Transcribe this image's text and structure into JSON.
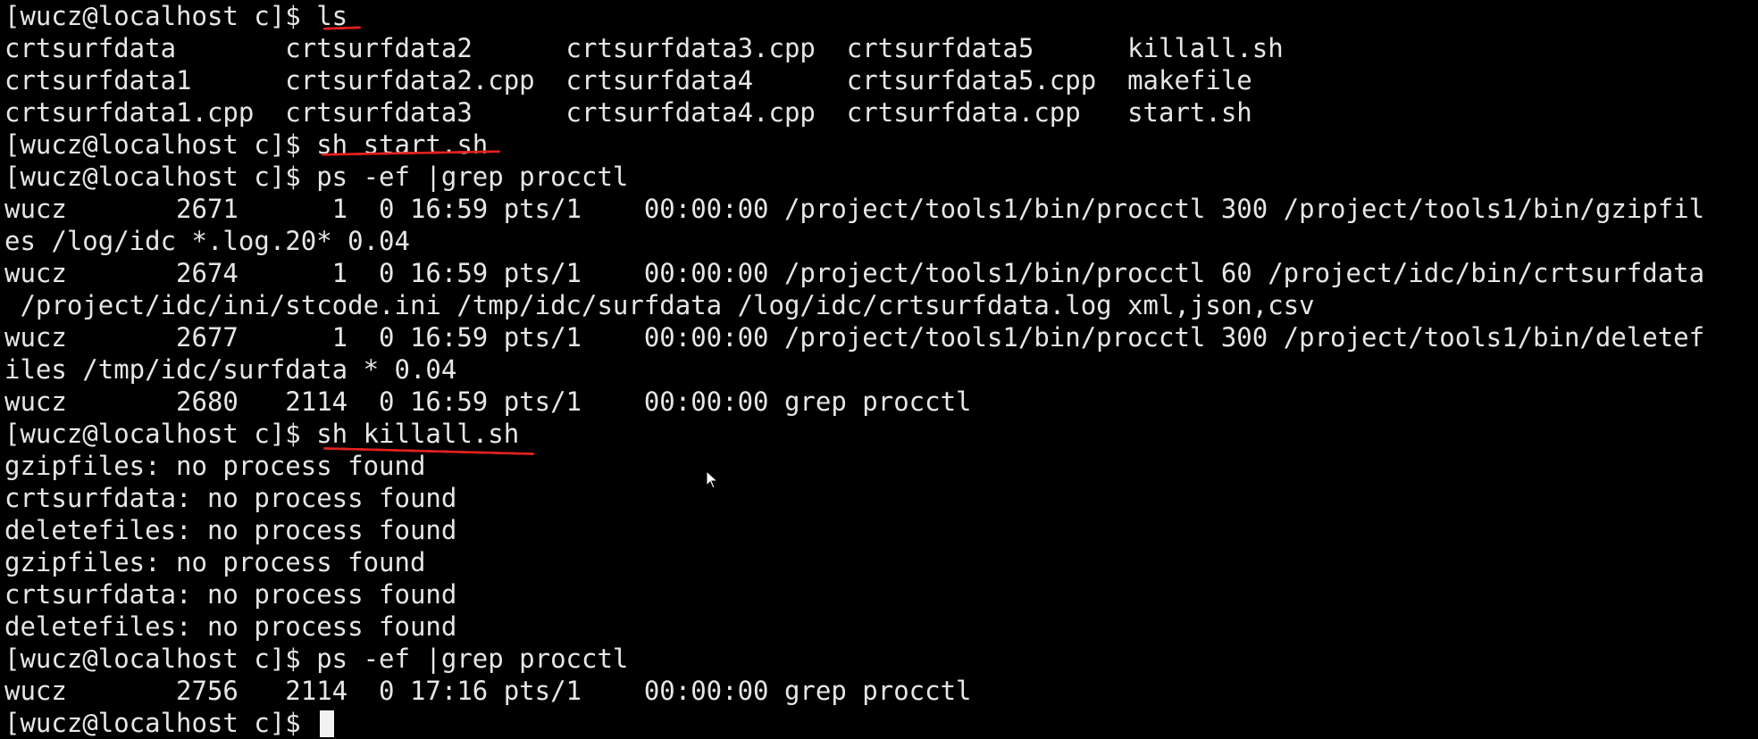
{
  "terminal": {
    "lines": [
      {
        "prompt": "[wucz@localhost c]$ ",
        "command": "ls"
      },
      {
        "text": "crtsurfdata       crtsurfdata2      crtsurfdata3.cpp  crtsurfdata5      killall.sh"
      },
      {
        "text": "crtsurfdata1      crtsurfdata2.cpp  crtsurfdata4      crtsurfdata5.cpp  makefile"
      },
      {
        "text": "crtsurfdata1.cpp  crtsurfdata3      crtsurfdata4.cpp  crtsurfdata.cpp   start.sh"
      },
      {
        "prompt": "[wucz@localhost c]$ ",
        "command": "sh start.sh"
      },
      {
        "prompt": "[wucz@localhost c]$ ",
        "command": "ps -ef |grep procctl"
      },
      {
        "text": "wucz       2671      1  0 16:59 pts/1    00:00:00 /project/tools1/bin/procctl 300 /project/tools1/bin/gzipfil"
      },
      {
        "text": "es /log/idc *.log.20* 0.04"
      },
      {
        "text": "wucz       2674      1  0 16:59 pts/1    00:00:00 /project/tools1/bin/procctl 60 /project/idc/bin/crtsurfdata"
      },
      {
        "text": " /project/idc/ini/stcode.ini /tmp/idc/surfdata /log/idc/crtsurfdata.log xml,json,csv"
      },
      {
        "text": "wucz       2677      1  0 16:59 pts/1    00:00:00 /project/tools1/bin/procctl 300 /project/tools1/bin/deletef"
      },
      {
        "text": "iles /tmp/idc/surfdata * 0.04"
      },
      {
        "text": "wucz       2680   2114  0 16:59 pts/1    00:00:00 grep procctl"
      },
      {
        "prompt": "[wucz@localhost c]$ ",
        "command": "sh killall.sh"
      },
      {
        "text": "gzipfiles: no process found"
      },
      {
        "text": "crtsurfdata: no process found"
      },
      {
        "text": "deletefiles: no process found"
      },
      {
        "text": "gzipfiles: no process found"
      },
      {
        "text": "crtsurfdata: no process found"
      },
      {
        "text": "deletefiles: no process found"
      },
      {
        "prompt": "[wucz@localhost c]$ ",
        "command": "ps -ef |grep procctl"
      },
      {
        "text": "wucz       2756   2114  0 17:16 pts/1    00:00:00 grep procctl"
      },
      {
        "prompt": "[wucz@localhost c]$ ",
        "command": ""
      }
    ]
  },
  "colors": {
    "background": "#000000",
    "foreground": "#e6e6e6",
    "annotation": "#e02020"
  },
  "icons": {
    "cursor": "text-cursor-block",
    "pointer": "mouse-pointer-icon"
  }
}
